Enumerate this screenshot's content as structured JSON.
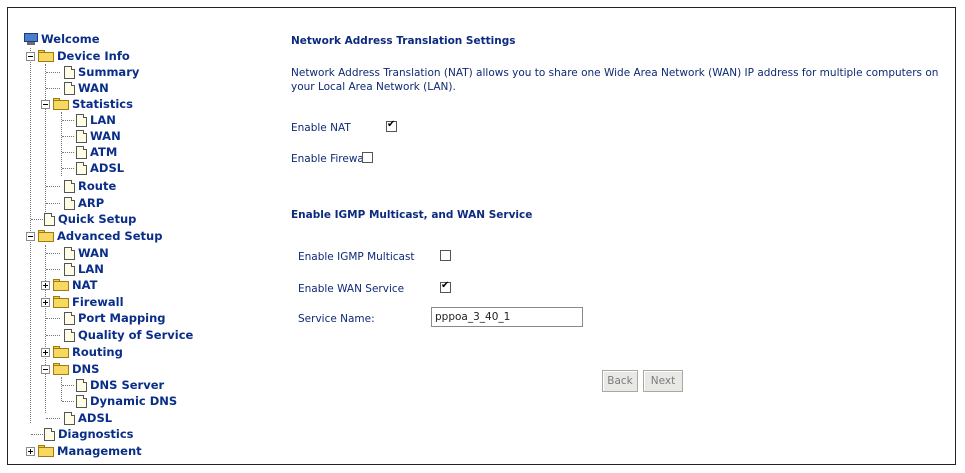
{
  "tree": {
    "welcome": "Welcome",
    "device_info": "Device Info",
    "summary": "Summary",
    "wan": "WAN",
    "statistics": "Statistics",
    "stats_lan": "LAN",
    "stats_wan": "WAN",
    "stats_atm": "ATM",
    "stats_adsl": "ADSL",
    "route": "Route",
    "arp": "ARP",
    "quick_setup": "Quick Setup",
    "advanced_setup": "Advanced Setup",
    "adv_wan": "WAN",
    "adv_lan": "LAN",
    "nat": "NAT",
    "firewall": "Firewall",
    "port_mapping": "Port Mapping",
    "qos": "Quality of Service",
    "routing": "Routing",
    "dns": "DNS",
    "dns_server": "DNS Server",
    "dynamic_dns": "Dynamic DNS",
    "adv_adsl": "ADSL",
    "diagnostics": "Diagnostics",
    "management": "Management"
  },
  "nat_section": {
    "title": "Network Address Translation Settings",
    "description": "Network Address Translation (NAT) allows you to share one Wide Area Network (WAN) IP address for multiple computers on your Local Area Network (LAN).",
    "enable_nat_label": "Enable NAT",
    "enable_nat_checked": true,
    "enable_firewall_label": "Enable Firewall",
    "enable_firewall_checked": false
  },
  "igmp_section": {
    "title": "Enable IGMP Multicast, and WAN Service",
    "igmp_label": "Enable IGMP Multicast",
    "igmp_checked": false,
    "wan_service_label": "Enable WAN Service",
    "wan_service_checked": true,
    "service_name_label": "Service Name:",
    "service_name_value": "pppoa_3_40_1"
  },
  "buttons": {
    "back": "Back",
    "next": "Next"
  }
}
